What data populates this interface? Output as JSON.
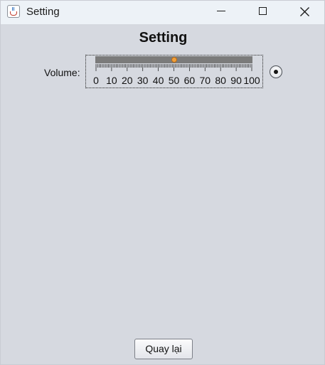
{
  "window": {
    "title": "Setting",
    "app_icon": "java-cup-icon",
    "controls": [
      "minimize-icon",
      "maximize-icon",
      "close-icon"
    ]
  },
  "main": {
    "heading": "Setting",
    "volume": {
      "label": "Volume:",
      "min": 0,
      "max": 100,
      "value": 50,
      "major_ticks": [
        "0",
        "10",
        "20",
        "30",
        "40",
        "50",
        "60",
        "70",
        "80",
        "90",
        "100"
      ],
      "thumb_color": "#f0a03c",
      "track_color": "#7b7b7b"
    },
    "radio": {
      "selected": true
    }
  },
  "footer": {
    "back_label": "Quay lại"
  }
}
